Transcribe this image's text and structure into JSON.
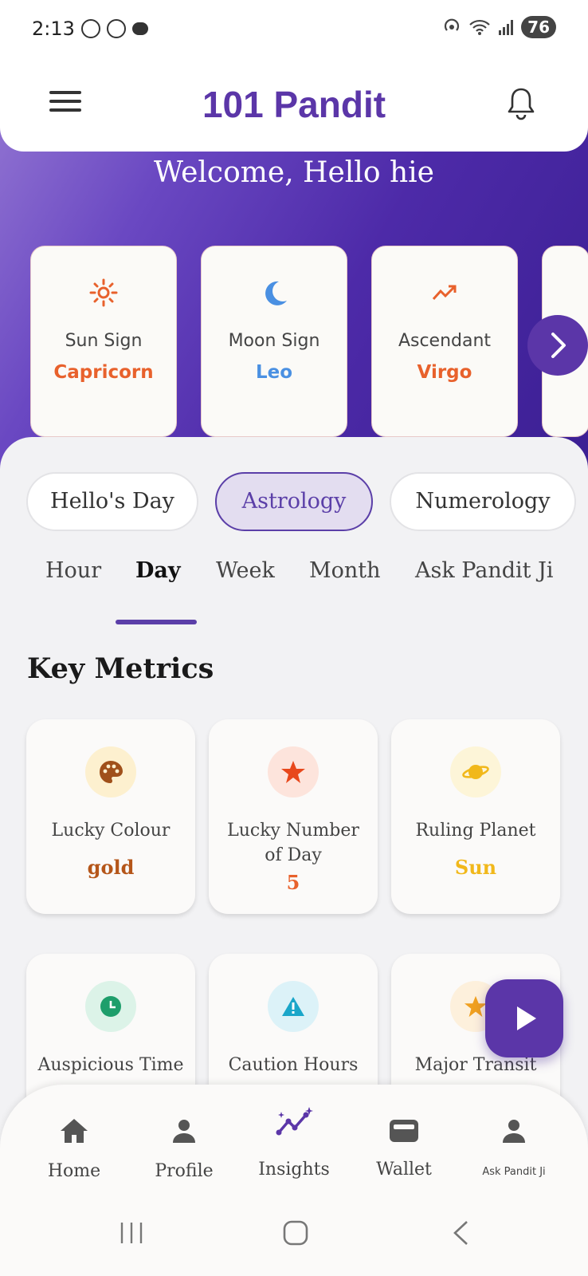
{
  "status_bar": {
    "time": "2:13",
    "battery": "76"
  },
  "header": {
    "title": "101 Pandit"
  },
  "welcome": "Welcome, Hello hie",
  "signs": [
    {
      "label": "Sun Sign",
      "value": "Capricorn",
      "icon": "sun-icon",
      "color": "#e8612c"
    },
    {
      "label": "Moon Sign",
      "value": "Leo",
      "icon": "moon-icon",
      "color": "#4a90e2"
    },
    {
      "label": "Ascendant",
      "value": "Virgo",
      "icon": "trending-up-icon",
      "color": "#e8612c"
    }
  ],
  "pills": [
    "Hello's Day",
    "Astrology",
    "Numerology"
  ],
  "active_pill": "Astrology",
  "tabs": [
    "Hour",
    "Day",
    "Week",
    "Month",
    "Ask Pandit Ji"
  ],
  "active_tab": "Day",
  "section_title": "Key Metrics",
  "metrics": [
    {
      "label": "Lucky Colour",
      "value": "gold",
      "icon": "palette-icon",
      "color": "#b5561a"
    },
    {
      "label": "Lucky Number of Day",
      "value": "5",
      "icon": "star-icon",
      "color": "#e8612c"
    },
    {
      "label": "Ruling Planet",
      "value": "Sun",
      "icon": "planet-icon",
      "color": "#f1b81b"
    },
    {
      "label": "Auspicious Time",
      "value": "",
      "icon": "clock-icon",
      "color": "#1e9e6b"
    },
    {
      "label": "Caution Hours",
      "value": "",
      "icon": "warning-icon",
      "color": "#1aa6c9"
    },
    {
      "label": "Major Transit",
      "value": "",
      "icon": "star-icon",
      "color": "#f0a020"
    }
  ],
  "bottom_nav": [
    "Home",
    "Profile",
    "Insights",
    "Wallet",
    "Ask Pandit Ji"
  ],
  "colors": {
    "brand": "#5b36a8",
    "accent": "#e8612c",
    "background": "#f2f2f4"
  }
}
